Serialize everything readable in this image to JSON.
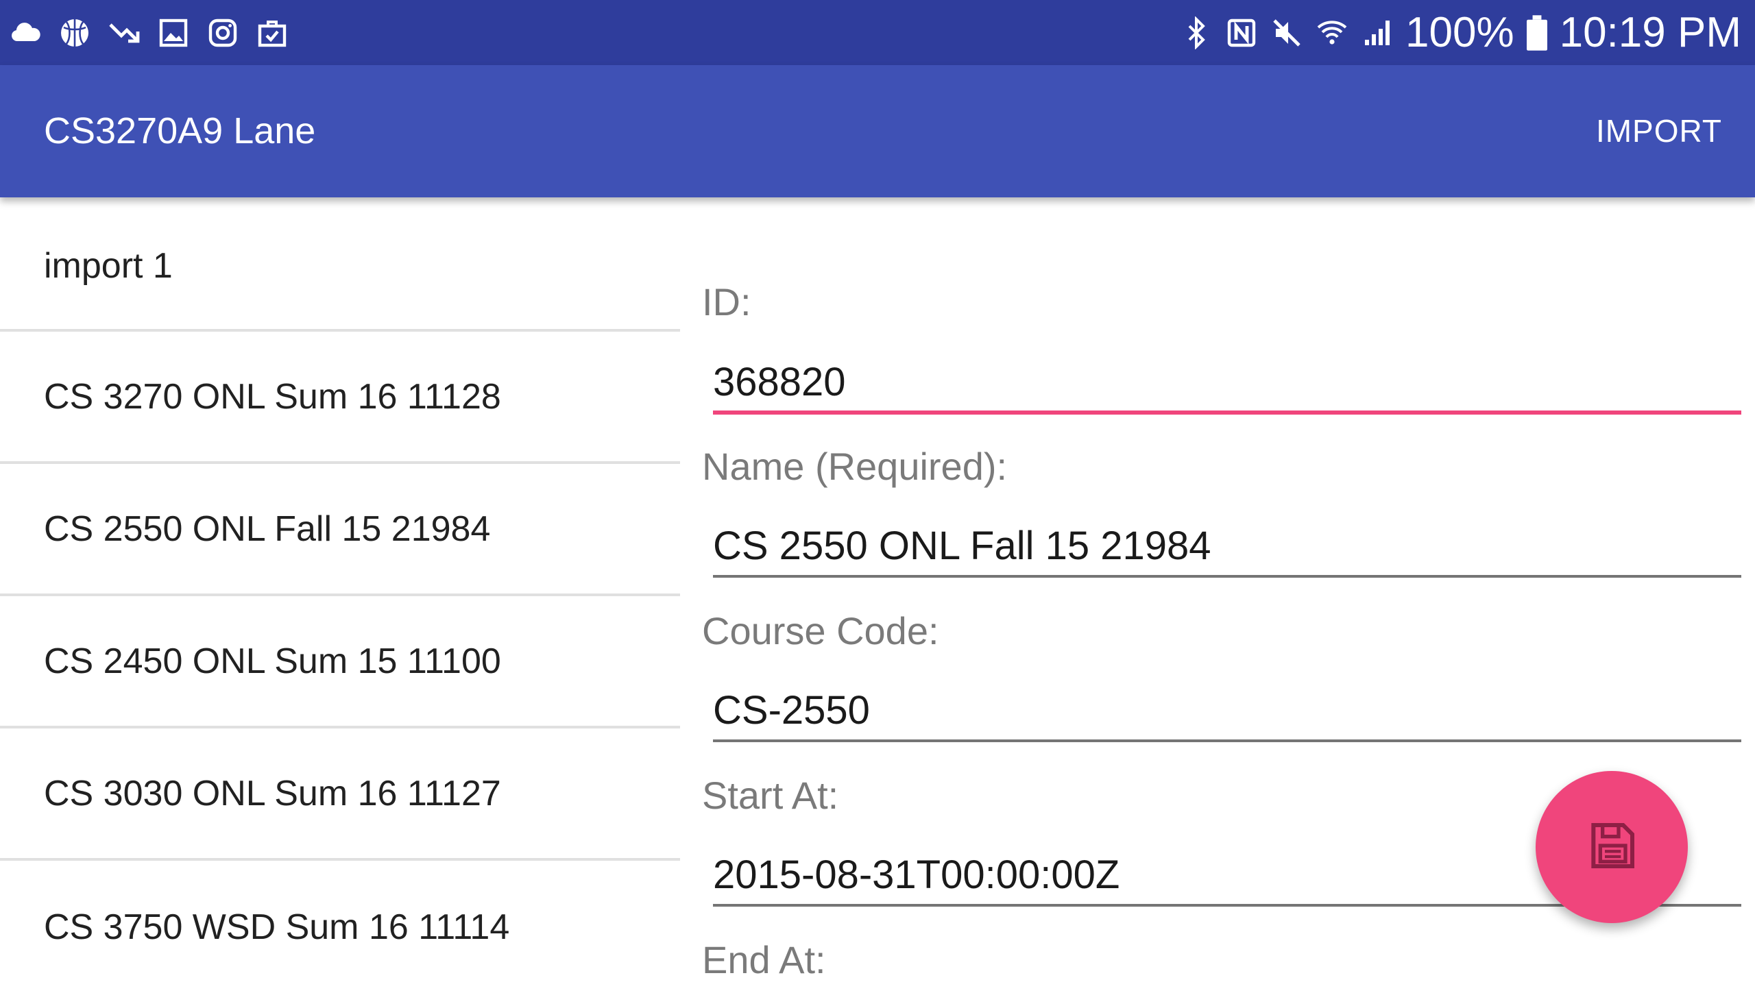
{
  "status_bar": {
    "left_icons": [
      "cloud-icon",
      "basketball-icon",
      "trending-down-icon",
      "image-icon",
      "instagram-icon",
      "briefcase-check-icon"
    ],
    "right_icons": [
      "bluetooth-icon",
      "nfc-icon",
      "mute-icon",
      "wifi-icon",
      "signal-icon"
    ],
    "battery": "100%",
    "time": "10:19 PM"
  },
  "app_bar": {
    "title": "CS3270A9 Lane",
    "action": "IMPORT"
  },
  "course_list": [
    {
      "label": "import 1"
    },
    {
      "label": "CS 3270 ONL Sum 16 11128"
    },
    {
      "label": "CS 2550 ONL Fall 15 21984"
    },
    {
      "label": "CS 2450 ONL Sum 15 11100"
    },
    {
      "label": "CS 3030 ONL Sum 16 11127"
    },
    {
      "label": "CS 3750 WSD Sum 16 11114"
    }
  ],
  "form": {
    "id_label": "ID:",
    "id_value": "368820",
    "name_label": "Name (Required):",
    "name_value": "CS 2550 ONL Fall 15 21984",
    "code_label": "Course Code:",
    "code_value": "CS-2550",
    "start_label": "Start At:",
    "start_value": "2015-08-31T00:00:00Z",
    "end_label": "End At:"
  },
  "colors": {
    "status_bar": "#2f3d9c",
    "app_bar": "#3f51b5",
    "accent": "#f0457c"
  },
  "fab_icon": "save-icon"
}
